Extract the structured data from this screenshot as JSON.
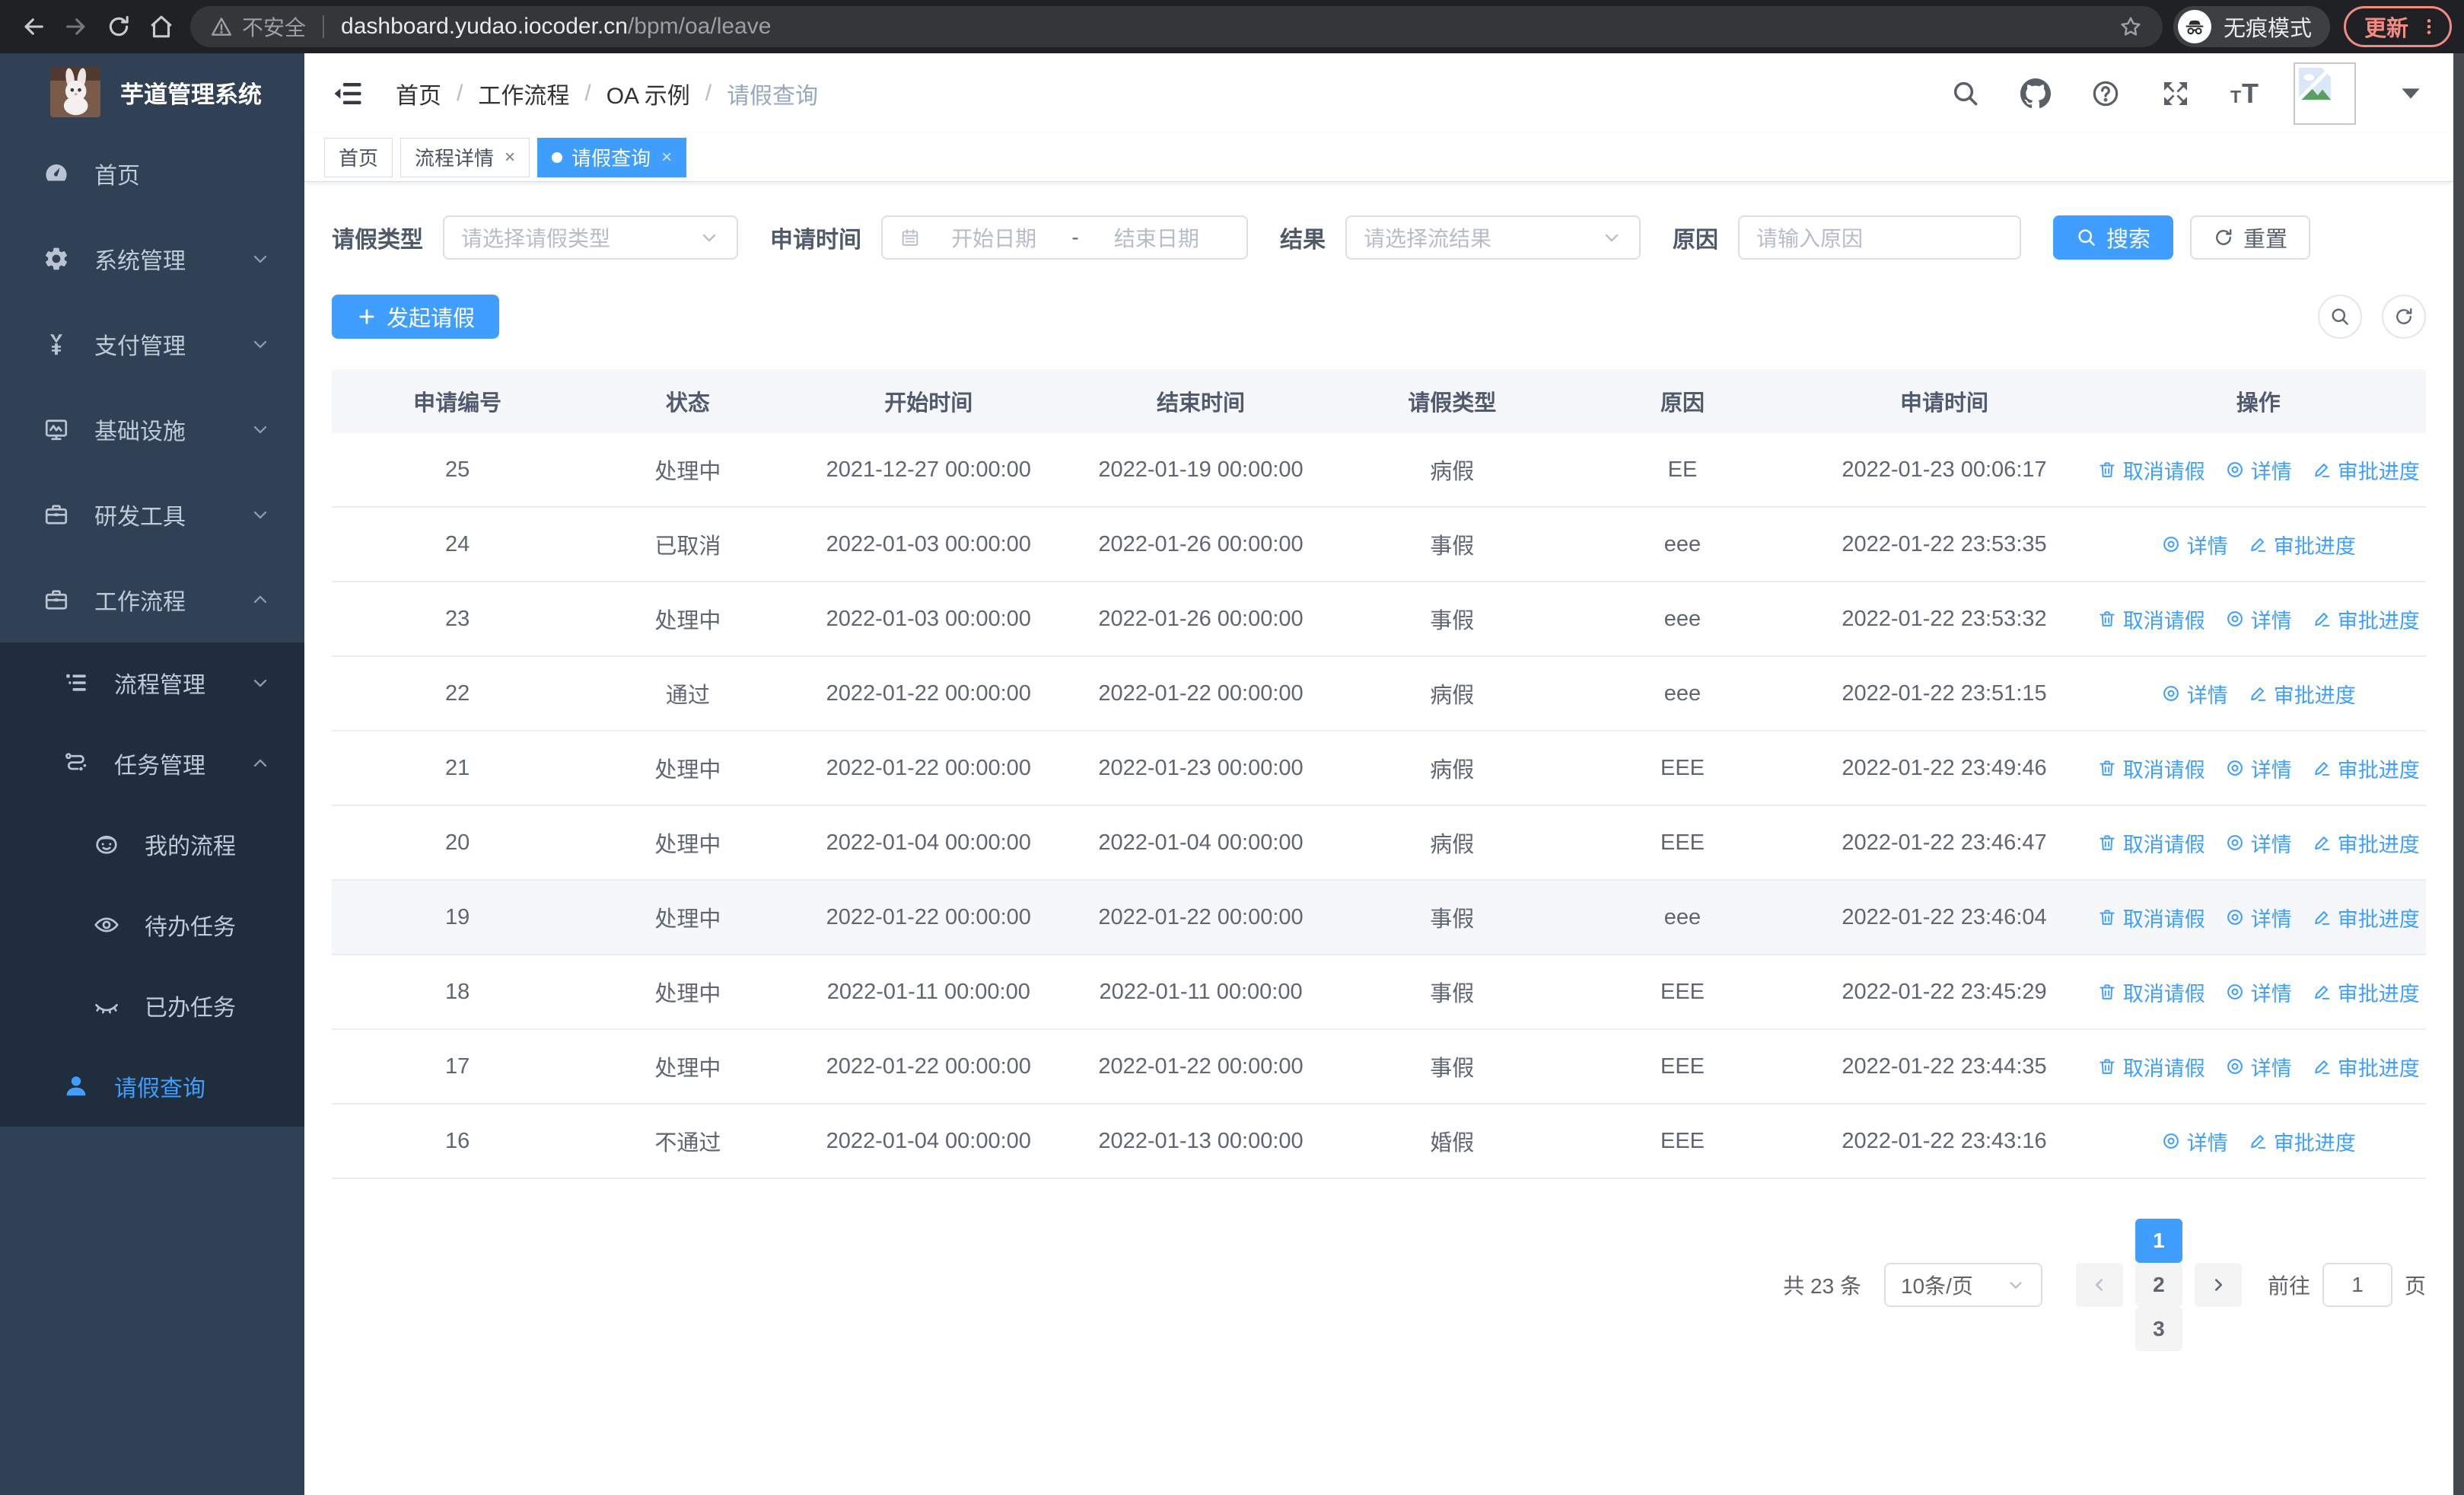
{
  "colors": {
    "accent": "#409eff",
    "sidebar_bg": "#304156",
    "submenu_bg": "#1f2d3d",
    "sidebar_text": "#bfcbd9",
    "update_button": "#f28b82",
    "table_header_bg": "#f5f7fa"
  },
  "browser": {
    "security_label": "不安全",
    "url_host": "dashboard.yudao.iocoder.cn",
    "url_path": "/bpm/oa/leave",
    "incognito_label": "无痕模式",
    "update_label": "更新"
  },
  "sidebar": {
    "title": "芋道管理系统",
    "items": [
      {
        "label": "首页",
        "icon": "dashboard-icon",
        "level": 1
      },
      {
        "label": "系统管理",
        "icon": "gear-icon",
        "level": 1,
        "chevron": "down"
      },
      {
        "label": "支付管理",
        "icon": "yen-icon",
        "level": 1,
        "chevron": "down"
      },
      {
        "label": "基础设施",
        "icon": "monitor-icon",
        "level": 1,
        "chevron": "down"
      },
      {
        "label": "研发工具",
        "icon": "toolbox-icon",
        "level": 1,
        "chevron": "down"
      },
      {
        "label": "工作流程",
        "icon": "briefcase-icon",
        "level": 1,
        "chevron": "up"
      },
      {
        "label": "流程管理",
        "icon": "tree-icon",
        "level": 2,
        "chevron": "down",
        "dark": true
      },
      {
        "label": "任务管理",
        "icon": "flow-icon",
        "level": 2,
        "chevron": "up",
        "dark": true
      },
      {
        "label": "我的流程",
        "icon": "face-icon",
        "level": 3,
        "dark": true
      },
      {
        "label": "待办任务",
        "icon": "eye-icon",
        "level": 3,
        "dark": true
      },
      {
        "label": "已办任务",
        "icon": "eye-closed-icon",
        "level": 3,
        "dark": true
      },
      {
        "label": "请假查询",
        "icon": "user-icon",
        "level": 2,
        "dark": true,
        "active": true
      }
    ]
  },
  "navbar": {
    "breadcrumb": [
      "首页",
      "工作流程",
      "OA 示例",
      "请假查询"
    ],
    "font_icon_small": "T",
    "font_icon_large": "T"
  },
  "tabs": [
    {
      "label": "首页",
      "closable": false,
      "active": false
    },
    {
      "label": "流程详情",
      "closable": true,
      "active": false
    },
    {
      "label": "请假查询",
      "closable": true,
      "active": true
    }
  ],
  "filters": {
    "leave_type_label": "请假类型",
    "leave_type_placeholder": "请选择请假类型",
    "apply_time_label": "申请时间",
    "start_date_placeholder": "开始日期",
    "range_separator": "-",
    "end_date_placeholder": "结束日期",
    "result_label": "结果",
    "result_placeholder": "请选择流结果",
    "reason_label": "原因",
    "reason_placeholder": "请输入原因",
    "search_label": "搜索",
    "reset_label": "重置"
  },
  "toolbar": {
    "create_label": "发起请假"
  },
  "table": {
    "columns": [
      "申请编号",
      "状态",
      "开始时间",
      "结束时间",
      "请假类型",
      "原因",
      "申请时间",
      "操作"
    ],
    "action_labels": {
      "cancel": "取消请假",
      "detail": "详情",
      "progress": "审批进度"
    },
    "rows": [
      {
        "id": "25",
        "status": "处理中",
        "start": "2021-12-27 00:00:00",
        "end": "2022-01-19 00:00:00",
        "type": "病假",
        "reason": "EE",
        "applied": "2022-01-23 00:06:17",
        "actions": [
          "cancel",
          "detail",
          "progress"
        ]
      },
      {
        "id": "24",
        "status": "已取消",
        "start": "2022-01-03 00:00:00",
        "end": "2022-01-26 00:00:00",
        "type": "事假",
        "reason": "eee",
        "applied": "2022-01-22 23:53:35",
        "actions": [
          "detail",
          "progress"
        ]
      },
      {
        "id": "23",
        "status": "处理中",
        "start": "2022-01-03 00:00:00",
        "end": "2022-01-26 00:00:00",
        "type": "事假",
        "reason": "eee",
        "applied": "2022-01-22 23:53:32",
        "actions": [
          "cancel",
          "detail",
          "progress"
        ]
      },
      {
        "id": "22",
        "status": "通过",
        "start": "2022-01-22 00:00:00",
        "end": "2022-01-22 00:00:00",
        "type": "病假",
        "reason": "eee",
        "applied": "2022-01-22 23:51:15",
        "actions": [
          "detail",
          "progress"
        ]
      },
      {
        "id": "21",
        "status": "处理中",
        "start": "2022-01-22 00:00:00",
        "end": "2022-01-23 00:00:00",
        "type": "病假",
        "reason": "EEE",
        "applied": "2022-01-22 23:49:46",
        "actions": [
          "cancel",
          "detail",
          "progress"
        ]
      },
      {
        "id": "20",
        "status": "处理中",
        "start": "2022-01-04 00:00:00",
        "end": "2022-01-04 00:00:00",
        "type": "病假",
        "reason": "EEE",
        "applied": "2022-01-22 23:46:47",
        "actions": [
          "cancel",
          "detail",
          "progress"
        ]
      },
      {
        "id": "19",
        "status": "处理中",
        "start": "2022-01-22 00:00:00",
        "end": "2022-01-22 00:00:00",
        "type": "事假",
        "reason": "eee",
        "applied": "2022-01-22 23:46:04",
        "actions": [
          "cancel",
          "detail",
          "progress"
        ],
        "highlighted": true
      },
      {
        "id": "18",
        "status": "处理中",
        "start": "2022-01-11 00:00:00",
        "end": "2022-01-11 00:00:00",
        "type": "事假",
        "reason": "EEE",
        "applied": "2022-01-22 23:45:29",
        "actions": [
          "cancel",
          "detail",
          "progress"
        ]
      },
      {
        "id": "17",
        "status": "处理中",
        "start": "2022-01-22 00:00:00",
        "end": "2022-01-22 00:00:00",
        "type": "事假",
        "reason": "EEE",
        "applied": "2022-01-22 23:44:35",
        "actions": [
          "cancel",
          "detail",
          "progress"
        ]
      },
      {
        "id": "16",
        "status": "不通过",
        "start": "2022-01-04 00:00:00",
        "end": "2022-01-13 00:00:00",
        "type": "婚假",
        "reason": "EEE",
        "applied": "2022-01-22 23:43:16",
        "actions": [
          "detail",
          "progress"
        ]
      }
    ]
  },
  "pagination": {
    "total_label": "共 23 条",
    "page_size": "10条/页",
    "pages": [
      "1",
      "2",
      "3"
    ],
    "active_page": "1",
    "goto_label": "前往",
    "goto_value": "1",
    "page_suffix": "页"
  }
}
